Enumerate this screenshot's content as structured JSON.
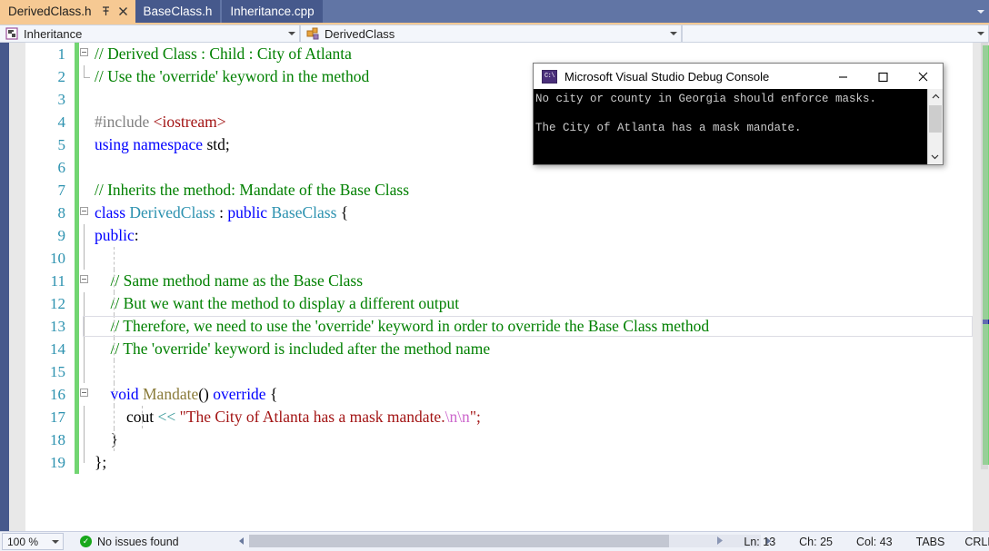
{
  "window": {
    "accent_tab_active": "#f6c993",
    "accent_chrome": "#6175a5",
    "tab_inactive_bg": "#46598c"
  },
  "tabs": [
    {
      "label": "DerivedClass.h",
      "active": true,
      "pin_icon": "pin-icon",
      "close_icon": "close-icon"
    },
    {
      "label": "BaseClass.h",
      "active": false
    },
    {
      "label": "Inheritance.cpp",
      "active": false
    }
  ],
  "tabstrip": {
    "overflow_icon": "chevron-down-icon"
  },
  "navbar": {
    "project": "Inheritance",
    "project_icon": "project-icon",
    "member": "DerivedClass",
    "member_icon": "class-member-icon",
    "dropdown_icon": "chevron-down-icon"
  },
  "editor": {
    "lines": [
      {
        "num": "1",
        "changed": true,
        "fold": "open-top",
        "indent": 0,
        "tokens": [
          {
            "t": "// Derived Class : Child : City of Atlanta",
            "c": "c-comment"
          }
        ]
      },
      {
        "num": "2",
        "changed": true,
        "fold": "elbow",
        "indent": 0,
        "tokens": [
          {
            "t": "// Use the 'override' keyword in the method",
            "c": "c-comment"
          }
        ]
      },
      {
        "num": "3",
        "changed": true,
        "fold": "none",
        "indent": 0,
        "tokens": []
      },
      {
        "num": "4",
        "changed": true,
        "fold": "none",
        "indent": 0,
        "tokens": [
          {
            "t": "#include ",
            "c": "c-pre"
          },
          {
            "t": "<iostream>",
            "c": "c-inc"
          }
        ]
      },
      {
        "num": "5",
        "changed": true,
        "fold": "none",
        "indent": 0,
        "tokens": [
          {
            "t": "using namespace ",
            "c": "c-keyword"
          },
          {
            "t": "std;",
            "c": "c-plain"
          }
        ]
      },
      {
        "num": "6",
        "changed": true,
        "fold": "none",
        "indent": 0,
        "tokens": []
      },
      {
        "num": "7",
        "changed": true,
        "fold": "none",
        "indent": 0,
        "tokens": [
          {
            "t": "// Inherits the method: Mandate of the Base Class",
            "c": "c-comment"
          }
        ]
      },
      {
        "num": "8",
        "changed": true,
        "fold": "open-top",
        "indent": 0,
        "tokens": [
          {
            "t": "class ",
            "c": "c-keyword"
          },
          {
            "t": "DerivedClass",
            "c": "c-type"
          },
          {
            "t": " : ",
            "c": "c-plain"
          },
          {
            "t": "public ",
            "c": "c-keyword"
          },
          {
            "t": "BaseClass",
            "c": "c-type"
          },
          {
            "t": " {",
            "c": "c-plain"
          }
        ]
      },
      {
        "num": "9",
        "changed": true,
        "fold": "line",
        "indent": 0,
        "tokens": [
          {
            "t": "public",
            "c": "c-keyword"
          },
          {
            "t": ":",
            "c": "c-plain"
          }
        ]
      },
      {
        "num": "10",
        "changed": true,
        "fold": "line",
        "indent": 1,
        "tokens": []
      },
      {
        "num": "11",
        "changed": true,
        "fold": "open-mid",
        "indent": 1,
        "tokens": [
          {
            "t": "    // Same method name as the Base Class",
            "c": "c-comment"
          }
        ]
      },
      {
        "num": "12",
        "changed": true,
        "fold": "line",
        "indent": 1,
        "tokens": [
          {
            "t": "    // But we want the method to display a different output",
            "c": "c-comment"
          }
        ]
      },
      {
        "num": "13",
        "changed": true,
        "fold": "line",
        "indent": 1,
        "current": true,
        "tokens": [
          {
            "t": "    // Therefore, we need to use the 'override' keyword in order to override the Base Class method",
            "c": "c-comment"
          }
        ]
      },
      {
        "num": "14",
        "changed": true,
        "fold": "line",
        "indent": 1,
        "tokens": [
          {
            "t": "    // The 'override' keyword is included after the method name",
            "c": "c-comment"
          }
        ]
      },
      {
        "num": "15",
        "changed": true,
        "fold": "line",
        "indent": 1,
        "tokens": []
      },
      {
        "num": "16",
        "changed": true,
        "fold": "open-mid",
        "indent": 1,
        "tokens": [
          {
            "t": "    ",
            "c": "c-plain"
          },
          {
            "t": "void ",
            "c": "c-keyword"
          },
          {
            "t": "Mandate",
            "c": "c-func"
          },
          {
            "t": "() ",
            "c": "c-plain"
          },
          {
            "t": "override",
            "c": "c-keyword"
          },
          {
            "t": " {",
            "c": "c-plain"
          }
        ]
      },
      {
        "num": "17",
        "changed": true,
        "fold": "line",
        "indent": 2,
        "tokens": [
          {
            "t": "        cout ",
            "c": "c-plain"
          },
          {
            "t": "<< ",
            "c": "c-op"
          },
          {
            "t": "\"The City of Atlanta has a mask mandate.",
            "c": "c-string"
          },
          {
            "t": "\\n\\n",
            "c": "c-esc"
          },
          {
            "t": "\";",
            "c": "c-string"
          }
        ]
      },
      {
        "num": "18",
        "changed": true,
        "fold": "line",
        "indent": 1,
        "tokens": [
          {
            "t": "    }",
            "c": "c-plain"
          }
        ]
      },
      {
        "num": "19",
        "changed": true,
        "fold": "line-end",
        "indent": 0,
        "tokens": [
          {
            "t": "};",
            "c": "c-plain"
          }
        ]
      }
    ],
    "colors": {
      "comment": "#008000",
      "keyword": "#0000ff",
      "type": "#2b91af",
      "string": "#a31515",
      "escape": "#cc66cc",
      "preprocessor": "#808080",
      "function": "#8a7b3a",
      "operator": "#3c9b9b",
      "line_number": "#2b91af",
      "change_bar": "#72d572"
    }
  },
  "console": {
    "title": "Microsoft Visual Studio Debug Console",
    "icon": "console-icon",
    "minimize_label": "—",
    "maximize_label": "☐",
    "close_label": "✕",
    "output": "No city or county in Georgia should enforce masks.\n\nThe City of Atlanta has a mask mandate.",
    "scroll_up_icon": "chevron-up-icon",
    "scroll_down_icon": "chevron-down-icon"
  },
  "statusbar": {
    "zoom": "100 %",
    "zoom_dropdown_icon": "chevron-down-icon",
    "issues": "No issues found",
    "issues_icon": "check-circle-icon",
    "scroll_left_icon": "arrow-left-icon",
    "scroll_right_icon": "arrow-right-icon",
    "play_icon": "arrow-right-icon",
    "line": "Ln: 13",
    "char": "Ch: 25",
    "col": "Col: 43",
    "tabs_mode": "TABS",
    "line_endings": "CRLF"
  }
}
